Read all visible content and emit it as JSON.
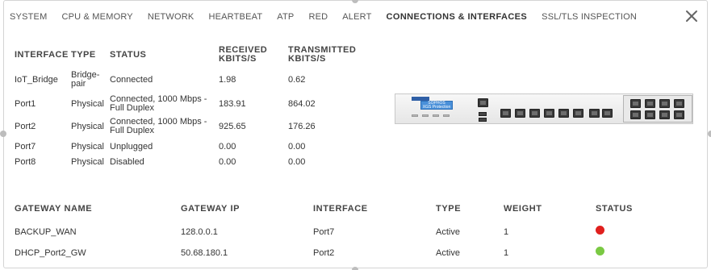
{
  "tabs": [
    {
      "label": "SYSTEM",
      "active": false
    },
    {
      "label": "CPU & MEMORY",
      "active": false
    },
    {
      "label": "NETWORK",
      "active": false
    },
    {
      "label": "HEARTBEAT",
      "active": false
    },
    {
      "label": "ATP",
      "active": false
    },
    {
      "label": "RED",
      "active": false
    },
    {
      "label": "ALERT",
      "active": false
    },
    {
      "label": "CONNECTIONS & INTERFACES",
      "active": true
    },
    {
      "label": "SSL/TLS INSPECTION",
      "active": false
    }
  ],
  "close_icon": "close-icon",
  "interfaces": {
    "headers": {
      "interface": "INTERFACE",
      "type": "TYPE",
      "status": "STATUS",
      "received": "RECEIVED KBITS/S",
      "transmitted": "TRANSMITTED KBITS/S"
    },
    "rows": [
      {
        "interface": "IoT_Bridge",
        "type": "Bridge-pair",
        "status": "Connected",
        "received": "1.98",
        "transmitted": "0.62"
      },
      {
        "interface": "Port1",
        "type": "Physical",
        "status": "Connected, 1000 Mbps - Full Duplex",
        "received": "183.91",
        "transmitted": "864.02"
      },
      {
        "interface": "Port2",
        "type": "Physical",
        "status": "Connected, 1000 Mbps - Full Duplex",
        "received": "925.65",
        "transmitted": "176.26"
      },
      {
        "interface": "Port7",
        "type": "Physical",
        "status": "Unplugged",
        "received": "0.00",
        "transmitted": "0.00"
      },
      {
        "interface": "Port8",
        "type": "Physical",
        "status": "Disabled",
        "received": "0.00",
        "transmitted": "0.00"
      }
    ]
  },
  "device": {
    "brand": "SOPHOS",
    "screen_text": "XGS Protection"
  },
  "gateways": {
    "headers": {
      "name": "GATEWAY NAME",
      "ip": "GATEWAY IP",
      "interface": "INTERFACE",
      "type": "TYPE",
      "weight": "WEIGHT",
      "status": "STATUS"
    },
    "rows": [
      {
        "name": "BACKUP_WAN",
        "ip": "128.0.0.1",
        "interface": "Port7",
        "type": "Active",
        "weight": "1",
        "status_color": "#e0201e"
      },
      {
        "name": "DHCP_Port2_GW",
        "ip": "50.68.180.1",
        "interface": "Port2",
        "type": "Active",
        "weight": "1",
        "status_color": "#7ac943"
      }
    ]
  }
}
